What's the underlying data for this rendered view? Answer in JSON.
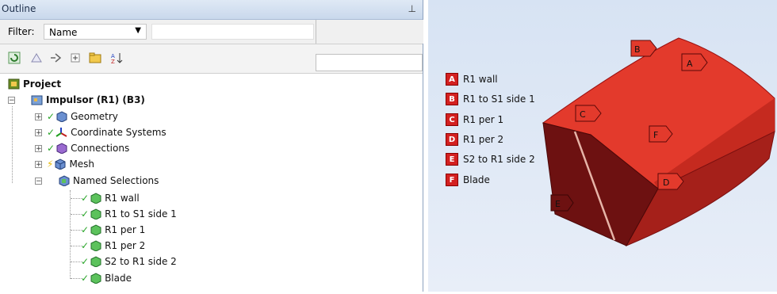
{
  "outline": {
    "title": "Outline",
    "filter_label": "Filter:",
    "filter_value": "Name"
  },
  "tree": {
    "project": "Project",
    "model": "Impulsor (R1) (B3)",
    "children": [
      "Geometry",
      "Coordinate Systems",
      "Connections",
      "Mesh",
      "Named Selections"
    ],
    "named_selections": [
      "R1 wall",
      "R1 to S1 side 1",
      "R1 per 1",
      "R1 per 2",
      "S2 to R1 side 2",
      "Blade"
    ]
  },
  "legend": [
    {
      "key": "A",
      "label": "R1 wall"
    },
    {
      "key": "B",
      "label": "R1 to S1 side 1"
    },
    {
      "key": "C",
      "label": "R1 per 1"
    },
    {
      "key": "D",
      "label": "R1 per 2"
    },
    {
      "key": "E",
      "label": "S2 to R1 side 2"
    },
    {
      "key": "F",
      "label": "Blade"
    }
  ],
  "model_tags": [
    "A",
    "B",
    "C",
    "D",
    "E",
    "F"
  ],
  "colors": {
    "selection_red": "#d32020",
    "tree_check": "#2aa52a"
  },
  "icons": [
    "pin-icon",
    "refresh-icon",
    "expand-all-icon",
    "collapse-icon",
    "tree-toggle-icon",
    "folder-icon",
    "sort-az-icon"
  ]
}
